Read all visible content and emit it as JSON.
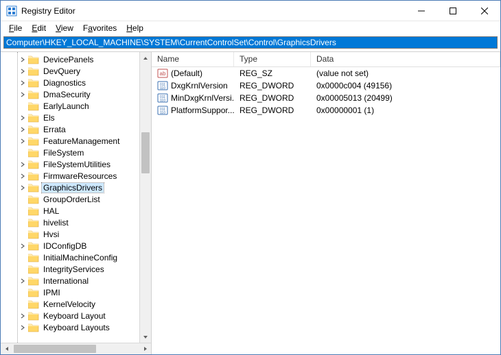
{
  "window": {
    "title": "Registry Editor"
  },
  "menubar": {
    "file": "File",
    "edit": "Edit",
    "view": "View",
    "favorites": "Favorites",
    "help": "Help"
  },
  "address": "Computer\\HKEY_LOCAL_MACHINE\\SYSTEM\\CurrentControlSet\\Control\\GraphicsDrivers",
  "tree": {
    "items": [
      {
        "label": "DevicePanels",
        "expandable": true
      },
      {
        "label": "DevQuery",
        "expandable": true
      },
      {
        "label": "Diagnostics",
        "expandable": true
      },
      {
        "label": "DmaSecurity",
        "expandable": true
      },
      {
        "label": "EarlyLaunch",
        "expandable": false
      },
      {
        "label": "Els",
        "expandable": true
      },
      {
        "label": "Errata",
        "expandable": true
      },
      {
        "label": "FeatureManagement",
        "expandable": true
      },
      {
        "label": "FileSystem",
        "expandable": false
      },
      {
        "label": "FileSystemUtilities",
        "expandable": true
      },
      {
        "label": "FirmwareResources",
        "expandable": true
      },
      {
        "label": "GraphicsDrivers",
        "expandable": true,
        "selected": true
      },
      {
        "label": "GroupOrderList",
        "expandable": false
      },
      {
        "label": "HAL",
        "expandable": false
      },
      {
        "label": "hivelist",
        "expandable": false
      },
      {
        "label": "Hvsi",
        "expandable": false
      },
      {
        "label": "IDConfigDB",
        "expandable": true
      },
      {
        "label": "InitialMachineConfig",
        "expandable": false
      },
      {
        "label": "IntegrityServices",
        "expandable": false
      },
      {
        "label": "International",
        "expandable": true
      },
      {
        "label": "IPMI",
        "expandable": false
      },
      {
        "label": "KernelVelocity",
        "expandable": false
      },
      {
        "label": "Keyboard Layout",
        "expandable": true
      },
      {
        "label": "Keyboard Layouts",
        "expandable": true
      }
    ]
  },
  "list": {
    "columns": {
      "name": "Name",
      "type": "Type",
      "data": "Data"
    },
    "rows": [
      {
        "icon": "string",
        "name": "(Default)",
        "type": "REG_SZ",
        "data": "(value not set)"
      },
      {
        "icon": "binary",
        "name": "DxgKrnlVersion",
        "type": "REG_DWORD",
        "data": "0x0000c004 (49156)"
      },
      {
        "icon": "binary",
        "name": "MinDxgKrnlVersi...",
        "type": "REG_DWORD",
        "data": "0x00005013 (20499)"
      },
      {
        "icon": "binary",
        "name": "PlatformSuppor...",
        "type": "REG_DWORD",
        "data": "0x00000001 (1)"
      }
    ]
  }
}
